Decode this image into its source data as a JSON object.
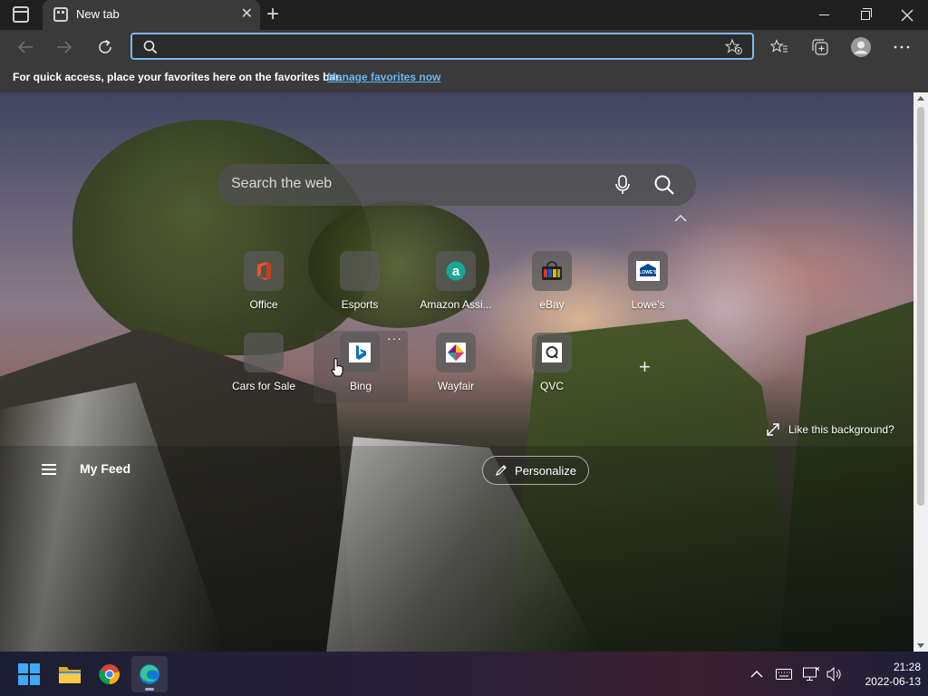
{
  "browser": {
    "tab_title": "New tab",
    "address_value": "",
    "favorites_bar_text": "For quick access, place your favorites here on the favorites bar.",
    "favorites_bar_link": "Manage favorites now"
  },
  "newtab": {
    "search_placeholder": "Search the web",
    "tiles": [
      {
        "label": "Office",
        "icon": "office-icon"
      },
      {
        "label": "Esports",
        "icon": "blank-icon"
      },
      {
        "label": "Amazon Assi...",
        "icon": "amazon-assistant-icon"
      },
      {
        "label": "eBay",
        "icon": "ebay-icon"
      },
      {
        "label": "Lowe's",
        "icon": "lowes-icon"
      },
      {
        "label": "Cars for Sale",
        "icon": "blank-icon"
      },
      {
        "label": "Bing",
        "icon": "bing-icon"
      },
      {
        "label": "Wayfair",
        "icon": "wayfair-icon"
      },
      {
        "label": "QVC",
        "icon": "qvc-icon"
      }
    ],
    "tile_more": "···",
    "lowes_logo_text": "LOWE'S",
    "background_prompt": "Like this background?",
    "feed_title": "My Feed",
    "personalize_label": "Personalize"
  },
  "taskbar": {
    "time": "21:28",
    "date": "2022-06-13",
    "apps": [
      "windows-start-icon",
      "file-explorer-icon",
      "chrome-icon",
      "edge-icon"
    ]
  }
}
